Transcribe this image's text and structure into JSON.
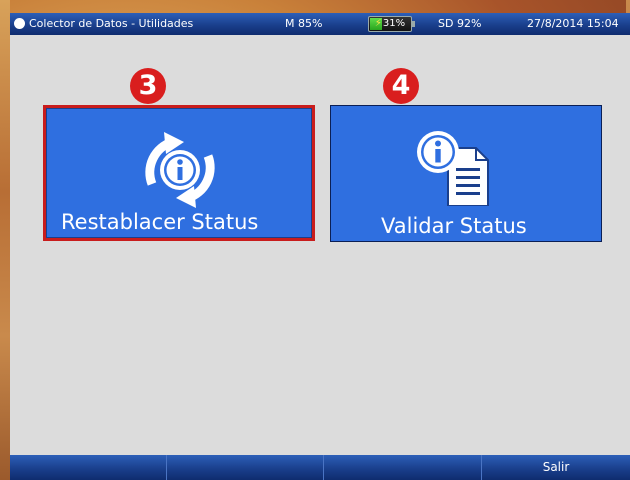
{
  "titlebar": {
    "title": "Colector de Datos - Utilidades",
    "memory": "M 85%",
    "battery": "31%",
    "battery_level": 0.31,
    "sd": "SD 92%",
    "datetime": "27/8/2014 15:04"
  },
  "badges": {
    "reset": "3",
    "validate": "4"
  },
  "tiles": {
    "reset_label": "Restablacer Status",
    "reset_icon": "refresh-info-icon",
    "validate_label": "Validar Status",
    "validate_icon": "info-document-icon"
  },
  "bottombar": {
    "key1": "",
    "key2": "",
    "key3": "",
    "key4": "Salir"
  },
  "colors": {
    "tile": "#2f6fe0",
    "highlight_border": "#c81c1c",
    "badge": "#d91e1e",
    "bar": "#1a3f8c",
    "background": "#dcdcdc"
  }
}
